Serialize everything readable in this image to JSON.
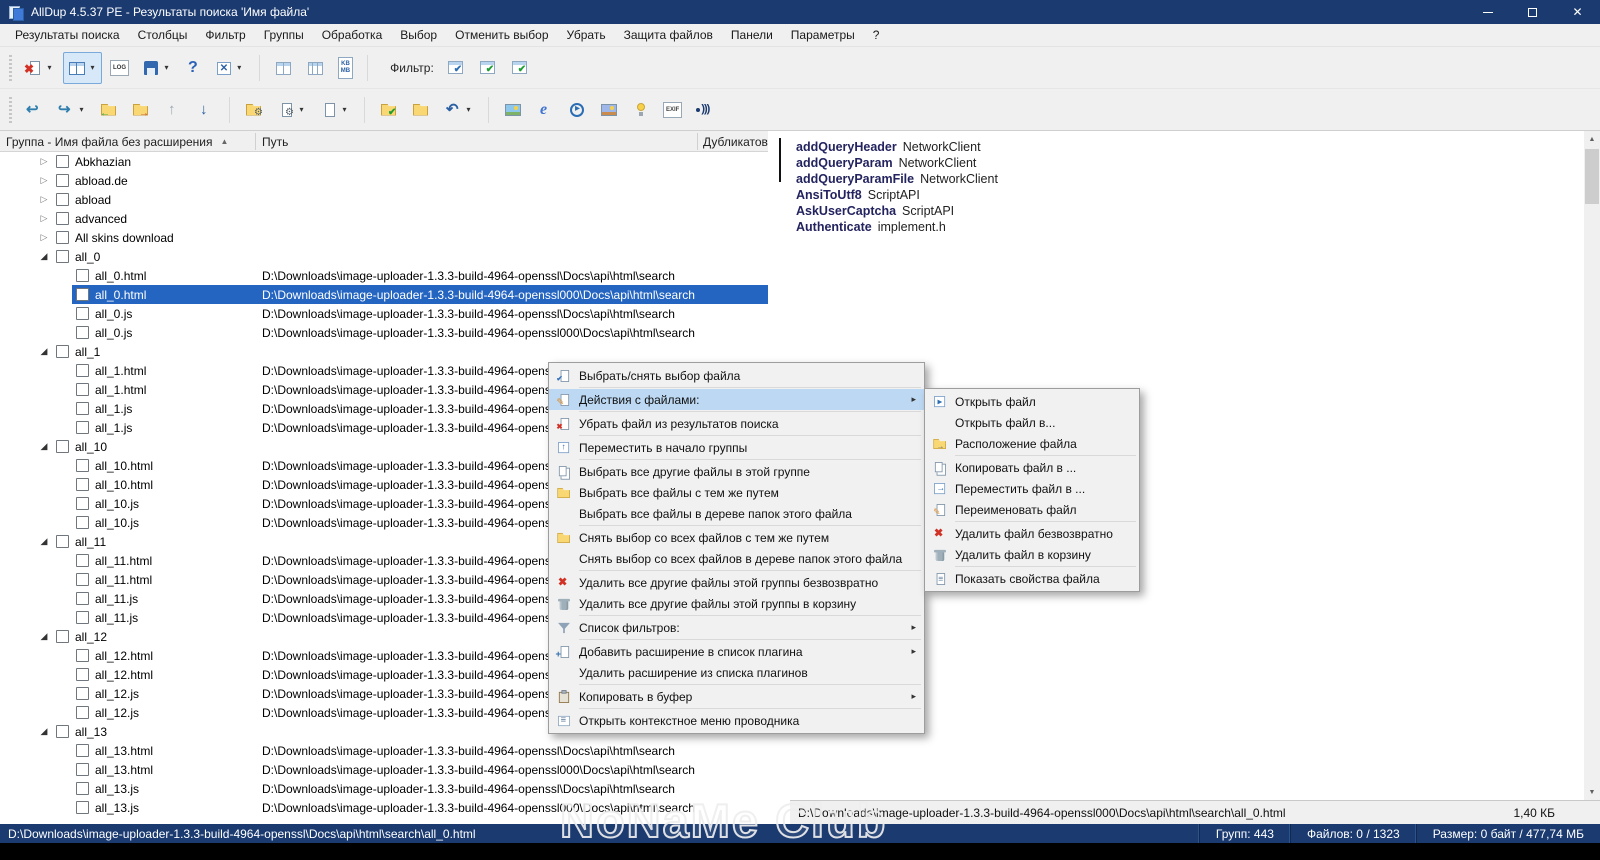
{
  "window": {
    "title": "AllDup 4.5.37 PE - Результаты поиска 'Имя файла'"
  },
  "menubar": {
    "items": [
      "Результаты поиска",
      "Столбцы",
      "Фильтр",
      "Группы",
      "Обработка",
      "Выбор",
      "Отменить выбор",
      "Убрать",
      "Защита файлов",
      "Панели",
      "Параметры",
      "?"
    ]
  },
  "toolbars": {
    "row1": [
      {
        "icon": "delete-file-icon",
        "dropdown": true
      },
      {
        "icon": "view-columns-icon",
        "dropdown": true,
        "selected": true
      },
      {
        "icon": "log-icon",
        "label": "LOG"
      },
      {
        "icon": "save-icon",
        "dropdown": true
      },
      {
        "icon": "help-icon",
        "label": "?"
      },
      {
        "icon": "close-search-icon",
        "dropdown": true
      },
      {
        "type": "sep"
      },
      {
        "icon": "column-layout-1-icon"
      },
      {
        "icon": "column-layout-2-icon"
      },
      {
        "icon": "size-unit-icon",
        "label": "KB\nMB"
      },
      {
        "type": "sep"
      },
      {
        "type": "label",
        "label": "Фильтр:",
        "name": "filter-label"
      },
      {
        "icon": "filter-checked-icon"
      },
      {
        "icon": "filter-green-icon"
      },
      {
        "icon": "filter-green2-icon"
      }
    ],
    "row2": [
      {
        "icon": "prev-file-icon"
      },
      {
        "icon": "next-file-icon",
        "dropdown": true
      },
      {
        "icon": "folder-import-icon"
      },
      {
        "icon": "folder-export-icon"
      },
      {
        "icon": "arrow-up-icon"
      },
      {
        "icon": "arrow-down-icon"
      },
      {
        "type": "sep"
      },
      {
        "icon": "folder-settings-icon"
      },
      {
        "icon": "file-settings-icon",
        "dropdown": true
      },
      {
        "icon": "new-file-icon",
        "dropdown": true
      },
      {
        "type": "sep"
      },
      {
        "icon": "folder-check-icon"
      },
      {
        "icon": "folder-plain-icon"
      },
      {
        "icon": "undo-icon",
        "dropdown": true
      },
      {
        "type": "sep"
      },
      {
        "icon": "image-preview-icon"
      },
      {
        "icon": "internet-explorer-icon"
      },
      {
        "icon": "play-media-icon"
      },
      {
        "icon": "image-viewer-icon"
      },
      {
        "icon": "lamp-icon"
      },
      {
        "icon": "exif-icon",
        "label": "EXIF"
      },
      {
        "icon": "audio-icon"
      }
    ]
  },
  "list": {
    "columns": [
      {
        "label": "Группа - Имя файла без расширения",
        "sort": "asc"
      },
      {
        "label": "Путь"
      },
      {
        "label": "Дубликатов"
      }
    ],
    "paths": {
      "a": "D:\\Downloads\\image-uploader-1.3.3-build-4964-openssl\\Docs\\api\\html\\search",
      "b": "D:\\Downloads\\image-uploader-1.3.3-build-4964-openssl000\\Docs\\api\\html\\search"
    },
    "rows": [
      {
        "type": "group",
        "label": "Abkhazian",
        "expanded": false
      },
      {
        "type": "group",
        "label": "abload.de",
        "expanded": false
      },
      {
        "type": "group",
        "label": "abload",
        "expanded": false
      },
      {
        "type": "group",
        "label": "advanced",
        "expanded": false
      },
      {
        "type": "group",
        "label": "All skins download",
        "expanded": false
      },
      {
        "type": "group",
        "label": "all_0",
        "expanded": true
      },
      {
        "type": "file",
        "label": "all_0.html",
        "path": "a"
      },
      {
        "type": "file",
        "label": "all_0.html",
        "path": "b",
        "selected": true
      },
      {
        "type": "file",
        "label": "all_0.js",
        "path": "a"
      },
      {
        "type": "file",
        "label": "all_0.js",
        "path": "b"
      },
      {
        "type": "group",
        "label": "all_1",
        "expanded": true
      },
      {
        "type": "file",
        "label": "all_1.html",
        "path": "a"
      },
      {
        "type": "file",
        "label": "all_1.html",
        "path": "b"
      },
      {
        "type": "file",
        "label": "all_1.js",
        "path": "a"
      },
      {
        "type": "file",
        "label": "all_1.js",
        "path": "b"
      },
      {
        "type": "group",
        "label": "all_10",
        "expanded": true
      },
      {
        "type": "file",
        "label": "all_10.html",
        "path": "a"
      },
      {
        "type": "file",
        "label": "all_10.html",
        "path": "b"
      },
      {
        "type": "file",
        "label": "all_10.js",
        "path": "a"
      },
      {
        "type": "file",
        "label": "all_10.js",
        "path": "b"
      },
      {
        "type": "group",
        "label": "all_11",
        "expanded": true
      },
      {
        "type": "file",
        "label": "all_11.html",
        "path": "a"
      },
      {
        "type": "file",
        "label": "all_11.html",
        "path": "b"
      },
      {
        "type": "file",
        "label": "all_11.js",
        "path": "a"
      },
      {
        "type": "file",
        "label": "all_11.js",
        "path": "b"
      },
      {
        "type": "group",
        "label": "all_12",
        "expanded": true
      },
      {
        "type": "file",
        "label": "all_12.html",
        "path": "a"
      },
      {
        "type": "file",
        "label": "all_12.html",
        "path": "b"
      },
      {
        "type": "file",
        "label": "all_12.js",
        "path": "a"
      },
      {
        "type": "file",
        "label": "all_12.js",
        "path": "b"
      },
      {
        "type": "group",
        "label": "all_13",
        "expanded": true
      },
      {
        "type": "file",
        "label": "all_13.html",
        "path": "a"
      },
      {
        "type": "file",
        "label": "all_13.html",
        "path": "b"
      },
      {
        "type": "file",
        "label": "all_13.js",
        "path": "a"
      },
      {
        "type": "file",
        "label": "all_13.js",
        "path": "b"
      }
    ]
  },
  "preview": {
    "lines": [
      {
        "name": "addQueryHeader",
        "value": "NetworkClient"
      },
      {
        "name": "addQueryParam",
        "value": "NetworkClient"
      },
      {
        "name": "addQueryParamFile",
        "value": "NetworkClient"
      },
      {
        "name": "AnsiToUtf8",
        "value": "ScriptAPI"
      },
      {
        "name": "AskUserCaptcha",
        "value": "ScriptAPI"
      },
      {
        "name": "Authenticate",
        "value": "implement.h"
      }
    ],
    "file_path": "D:\\Downloads\\image-uploader-1.3.3-build-4964-openssl000\\Docs\\api\\html\\search\\all_0.html",
    "file_size": "1,40 КБ"
  },
  "context_menu": {
    "groups": [
      [
        {
          "icon": "select-file-icon",
          "label": "Выбрать/снять выбор файла"
        }
      ],
      [
        {
          "icon": "file-actions-icon",
          "label": "Действия с файлами:",
          "submenu": true,
          "highlighted": true
        }
      ],
      [
        {
          "icon": "remove-result-icon",
          "label": "Убрать файл из результатов поиска"
        }
      ],
      [
        {
          "icon": "move-top-group-icon",
          "label": "Переместить в начало группы"
        }
      ],
      [
        {
          "icon": "select-group-files-icon",
          "label": "Выбрать все другие файлы в этой группе"
        },
        {
          "icon": "folder-path-select-icon",
          "label": "Выбрать все файлы с тем же путем"
        },
        {
          "label": "Выбрать все файлы в дереве папок этого файла"
        }
      ],
      [
        {
          "icon": "folder-path-deselect-icon",
          "label": "Снять выбор со всех файлов с тем же путем"
        },
        {
          "label": "Снять выбор со всех файлов в дереве папок этого файла"
        }
      ],
      [
        {
          "icon": "delete-forever-icon",
          "label": "Удалить все другие файлы этой группы безвозвратно"
        },
        {
          "icon": "trash-icon",
          "label": "Удалить все другие файлы этой группы в корзину"
        }
      ],
      [
        {
          "icon": "filter-list-icon",
          "label": "Список фильтров:",
          "submenu": true
        }
      ],
      [
        {
          "icon": "add-extension-icon",
          "label": "Добавить расширение в список плагина",
          "submenu": true
        },
        {
          "label": "Удалить расширение из списка плагинов"
        }
      ],
      [
        {
          "icon": "clipboard-icon",
          "label": "Копировать в буфер",
          "submenu": true
        }
      ],
      [
        {
          "icon": "explorer-menu-icon",
          "label": "Открыть контекстное меню проводника"
        }
      ]
    ]
  },
  "submenu": {
    "groups": [
      [
        {
          "icon": "open-file-icon",
          "label": "Открыть файл"
        },
        {
          "label": "Открыть файл в..."
        },
        {
          "icon": "file-location-icon",
          "label": "Расположение файла"
        }
      ],
      [
        {
          "icon": "copy-file-icon",
          "label": "Копировать файл в ..."
        },
        {
          "icon": "move-file-icon",
          "label": "Переместить файл в ..."
        },
        {
          "icon": "rename-file-icon",
          "label": "Переименовать файл"
        }
      ],
      [
        {
          "icon": "delete-forever-icon",
          "label": "Удалить файл безвозвратно"
        },
        {
          "icon": "trash-icon",
          "label": "Удалить файл в корзину"
        }
      ],
      [
        {
          "icon": "file-properties-icon",
          "label": "Показать свойства файла"
        }
      ]
    ]
  },
  "statusbar": {
    "path": "D:\\Downloads\\image-uploader-1.3.3-build-4964-openssl\\Docs\\api\\html\\search\\all_0.html",
    "groups": "Групп: 443",
    "files": "Файлов: 0 / 1323",
    "size": "Размер: 0 байт / 477,74 МБ"
  },
  "watermark": "NoNaMe Club"
}
